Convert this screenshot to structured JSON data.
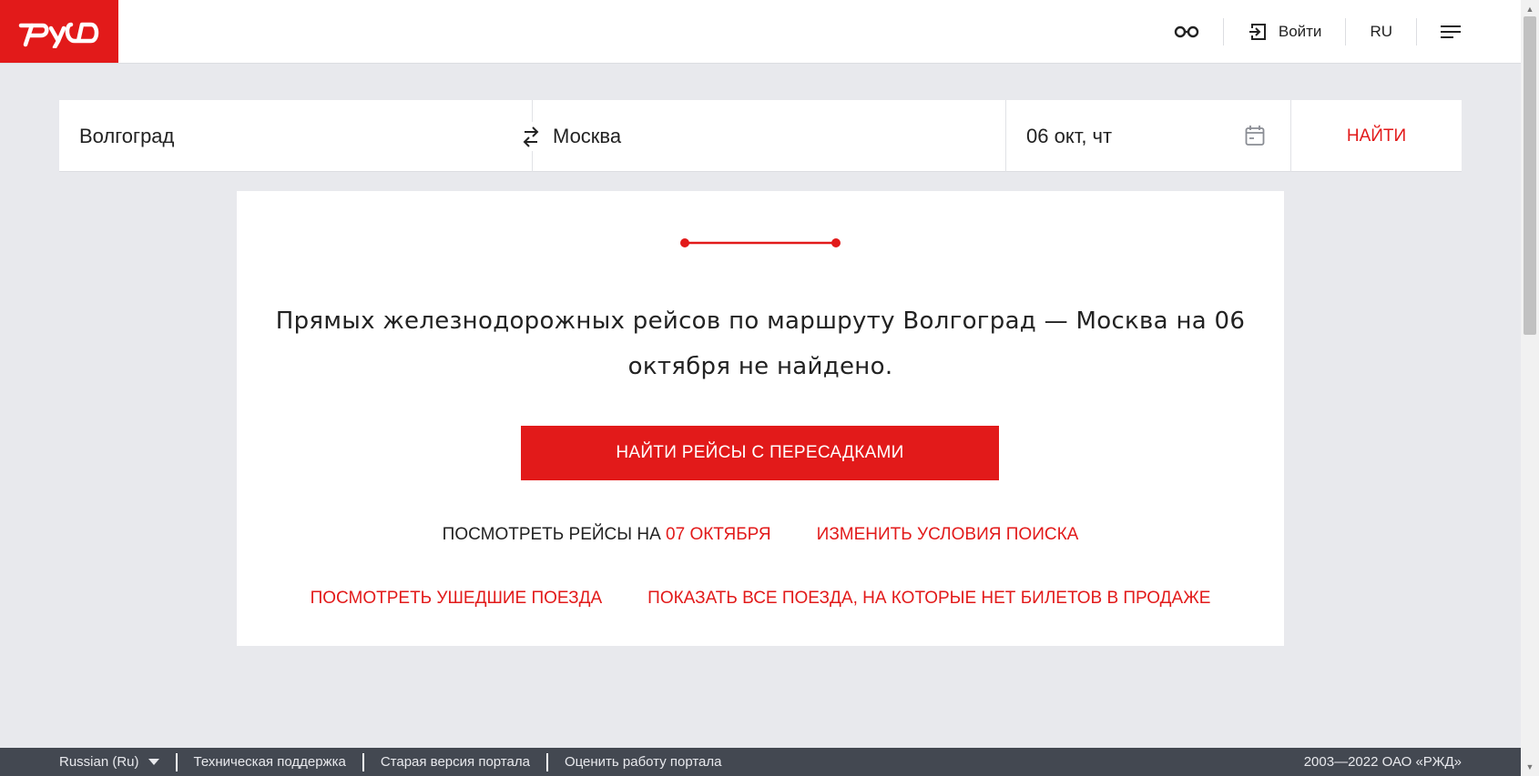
{
  "header": {
    "logo_alt": "РЖД",
    "login_label": "Войти",
    "language": "RU"
  },
  "search": {
    "from": "Волгоград",
    "to": "Москва",
    "date": "06 окт, чт",
    "find_label": "НАЙТИ"
  },
  "result": {
    "message": "Прямых железнодорожных рейсов по маршруту Волгоград — Москва на 06 октября не найдено.",
    "transfer_button": "НАЙТИ РЕЙСЫ С ПЕРЕСАДКАМИ",
    "view_prefix": "ПОСМОТРЕТЬ РЕЙСЫ НА",
    "view_date_link": "07 ОКТЯБРЯ",
    "change_search": "ИЗМЕНИТЬ УСЛОВИЯ ПОИСКА",
    "departed_trains": "ПОСМОТРЕТЬ УШЕДШИЕ ПОЕЗДА",
    "all_trains_no_tickets": "ПОКАЗАТЬ ВСЕ ПОЕЗДА, НА КОТОРЫЕ НЕТ БИЛЕТОВ В ПРОДАЖЕ"
  },
  "footer": {
    "language": "Russian  (Ru)",
    "support": "Техническая поддержка",
    "old_version": "Старая версия портала",
    "rate": "Оценить работу портала",
    "copyright": "2003—2022 ОАО «РЖД»"
  },
  "colors": {
    "brand_red": "#e21a1a",
    "background": "#e8e9ed",
    "footer_bg": "#434851"
  },
  "icons": [
    "logo-rzd",
    "glasses-icon",
    "login-icon",
    "menu-icon",
    "swap-icon",
    "calendar-icon",
    "route-icon",
    "chevron-down-icon"
  ]
}
